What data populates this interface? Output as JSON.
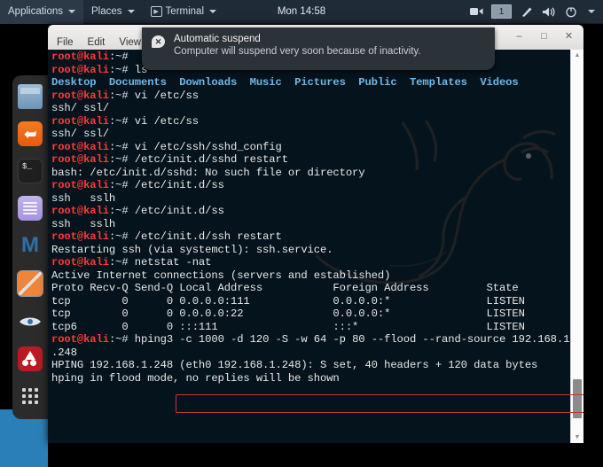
{
  "topbar": {
    "applications": "Applications",
    "places": "Places",
    "terminal": "Terminal",
    "clock": "Mon 14:58",
    "workspace": "1"
  },
  "notification": {
    "title": "Automatic suspend",
    "body": "Computer will suspend very soon because of inactivity."
  },
  "window": {
    "menu": [
      "File",
      "Edit",
      "View"
    ],
    "controls": {
      "minimize": "–",
      "maximize": "□",
      "close": "✕"
    }
  },
  "terminal": {
    "prompt": "root@kali",
    "prompt_tail": ":~# ",
    "lines": [
      {
        "type": "prompt",
        "cmd": ""
      },
      {
        "type": "prompt",
        "cmd": "ls"
      },
      {
        "type": "dirs",
        "text": "Desktop  Documents  Downloads  Music  Pictures  Public  Templates  Videos"
      },
      {
        "type": "prompt",
        "cmd": "vi /etc/ss"
      },
      {
        "type": "out",
        "text": "ssh/ ssl/"
      },
      {
        "type": "prompt",
        "cmd": "vi /etc/ss"
      },
      {
        "type": "out",
        "text": "ssh/ ssl/"
      },
      {
        "type": "prompt",
        "cmd": "vi /etc/ssh/sshd_config"
      },
      {
        "type": "prompt",
        "cmd": "/etc/init.d/sshd restart"
      },
      {
        "type": "out",
        "text": "bash: /etc/init.d/sshd: No such file or directory"
      },
      {
        "type": "prompt",
        "cmd": "/etc/init.d/ss"
      },
      {
        "type": "out",
        "text": "ssh   sslh"
      },
      {
        "type": "prompt",
        "cmd": "/etc/init.d/ss"
      },
      {
        "type": "out",
        "text": "ssh   sslh"
      },
      {
        "type": "prompt",
        "cmd": "/etc/init.d/ssh restart"
      },
      {
        "type": "out",
        "text": "Restarting ssh (via systemctl): ssh.service."
      },
      {
        "type": "prompt",
        "cmd": "netstat -nat"
      },
      {
        "type": "out",
        "text": "Active Internet connections (servers and established)"
      },
      {
        "type": "out",
        "text": "Proto Recv-Q Send-Q Local Address           Foreign Address         State"
      },
      {
        "type": "out",
        "text": "tcp        0      0 0.0.0.0:111             0.0.0.0:*               LISTEN"
      },
      {
        "type": "out",
        "text": "tcp        0      0 0.0.0.0:22              0.0.0.0:*               LISTEN"
      },
      {
        "type": "out",
        "text": "tcp6       0      0 :::111                  :::*                    LISTEN"
      },
      {
        "type": "prompt",
        "cmd": "hping3 -c 1000 -d 120 -S -w 64 -p 80 --flood --rand-source 192.168.1"
      },
      {
        "type": "out",
        "text": ".248"
      },
      {
        "type": "out",
        "text": "HPING 192.168.1.248 (eth0 192.168.1.248): S set, 40 headers + 120 data bytes"
      },
      {
        "type": "out",
        "text": "hping in flood mode, no replies will be shown"
      }
    ]
  },
  "dock": {
    "items": [
      {
        "name": "files",
        "label": "Files"
      },
      {
        "name": "firefox",
        "label": "Firefox"
      },
      {
        "name": "terminal",
        "label": "Terminal",
        "glyph": "$_"
      },
      {
        "name": "text-editor",
        "label": "Text Editor"
      },
      {
        "name": "metasploit",
        "label": "Metasploit",
        "glyph": "M"
      },
      {
        "name": "burpsuite",
        "label": "Burp Suite"
      },
      {
        "name": "wireshark",
        "label": "Wireshark",
        "glyph": "◉"
      },
      {
        "name": "beef",
        "label": "BeEF"
      },
      {
        "name": "show-applications",
        "label": "Show Applications"
      }
    ]
  },
  "colors": {
    "prompt_red": "#ff3a3a",
    "dir_blue": "#6fb7e8",
    "terminal_bg": "#05131c",
    "annotation_red": "#c0392b",
    "panel_bg": "#202b38"
  }
}
